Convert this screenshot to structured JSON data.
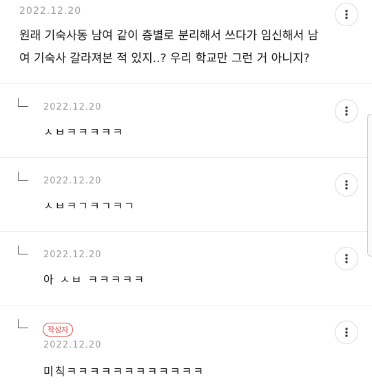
{
  "post": {
    "date": "2022.12.20",
    "body": "원래 기숙사동 남여 같이 층별로 분리해서 쓰다가 임신해서 남 여 기숙사 갈라져본 적 있지..? 우리 학교만 그런 거 아니지?",
    "more_icon": "more-vertical-icon"
  },
  "replies": [
    {
      "date": "2022.12.20",
      "text": "ㅅㅂㅋㅋㅋㅋㅋ",
      "more_icon": "more-vertical-icon"
    },
    {
      "date": "2022.12.20",
      "text": "ㅅㅂㅋㄱㅋㄱㅋㄱ",
      "more_icon": "more-vertical-icon"
    },
    {
      "date": "2022.12.20",
      "text": "아 ㅅㅂ ㅋㅋㅋㅋㅋ",
      "more_icon": "more-vertical-icon"
    },
    {
      "badge": "작성자",
      "date": "2022.12.20",
      "text": "미칙ㅋㅋㅋㅋㅋㅋㅋㅋㅋㅋㅋㅋ",
      "more_icon": "more-vertical-icon"
    }
  ],
  "colors": {
    "badge": "#e0453e",
    "date": "#9a9a9a",
    "divider": "#ececec"
  }
}
